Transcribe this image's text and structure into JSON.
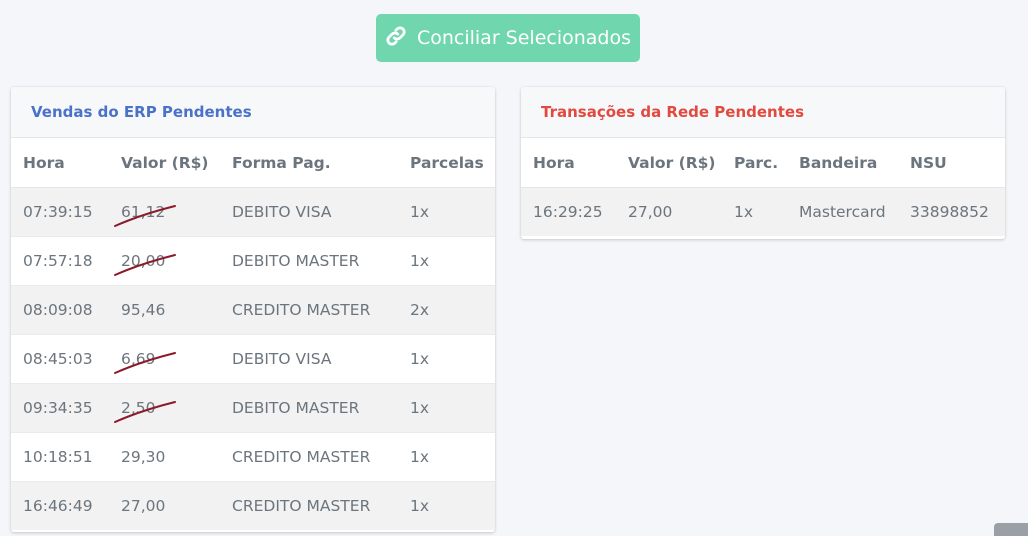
{
  "toolbar": {
    "conciliar_label": "Conciliar Selecionados"
  },
  "erp": {
    "title": "Vendas do ERP Pendentes",
    "headers": [
      "Hora",
      "Valor (R$)",
      "Forma Pag.",
      "Parcelas"
    ],
    "rows": [
      {
        "hora": "07:39:15",
        "valor": "61,12",
        "forma": "DEBITO VISA",
        "parcelas": "1x",
        "struck": true
      },
      {
        "hora": "07:57:18",
        "valor": "20,00",
        "forma": "DEBITO MASTER",
        "parcelas": "1x",
        "struck": true
      },
      {
        "hora": "08:09:08",
        "valor": "95,46",
        "forma": "CREDITO MASTER",
        "parcelas": "2x",
        "struck": false
      },
      {
        "hora": "08:45:03",
        "valor": "6,69",
        "forma": "DEBITO VISA",
        "parcelas": "1x",
        "struck": true
      },
      {
        "hora": "09:34:35",
        "valor": "2,50",
        "forma": "DEBITO MASTER",
        "parcelas": "1x",
        "struck": true
      },
      {
        "hora": "10:18:51",
        "valor": "29,30",
        "forma": "CREDITO MASTER",
        "parcelas": "1x",
        "struck": false
      },
      {
        "hora": "16:46:49",
        "valor": "27,00",
        "forma": "CREDITO MASTER",
        "parcelas": "1x",
        "struck": false
      }
    ]
  },
  "rede": {
    "title": "Transações da Rede Pendentes",
    "headers": [
      "Hora",
      "Valor (R$)",
      "Parc.",
      "Bandeira",
      "NSU"
    ],
    "rows": [
      {
        "hora": "16:29:25",
        "valor": "27,00",
        "parc": "1x",
        "bandeira": "Mastercard",
        "nsu": "33898852"
      }
    ]
  },
  "colors": {
    "button": "#6fd6ae",
    "erp_title": "#4a72c9",
    "rede_title": "#e04a3f",
    "strike_mark": "#8b1a2b"
  },
  "icons": {
    "conciliar": "link-icon"
  }
}
